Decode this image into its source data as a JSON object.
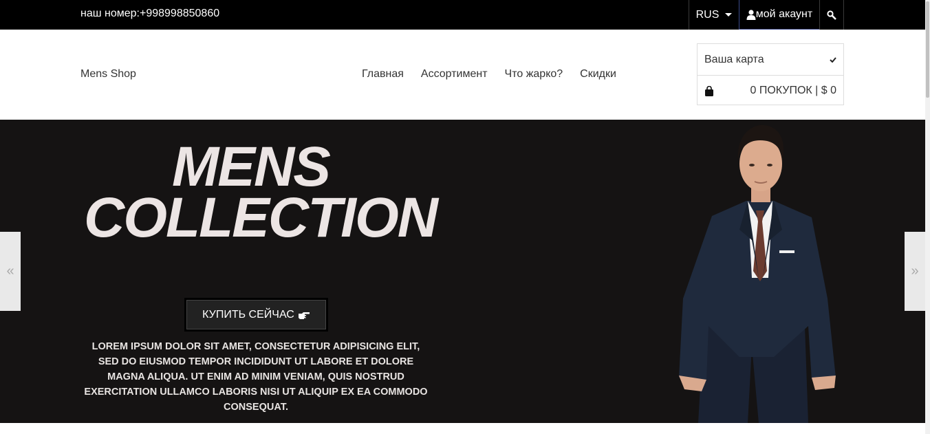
{
  "topbar": {
    "phone": "наш номер:+998998850860",
    "language": "RUS",
    "account": "мой акаунт"
  },
  "header": {
    "brand": "Mens Shop",
    "nav": [
      "Главная",
      "Ассортимент",
      "Что жарко?",
      "Скидки"
    ],
    "cart": {
      "title": "Ваша карта",
      "summary": "0 ПОКУПОК | $ 0"
    }
  },
  "hero": {
    "title_line1": "MENS",
    "title_line2": "COLLECTION",
    "buy_button": "КУПИТЬ СЕЙЧАС",
    "description": "LOREM IPSUM DOLOR SIT AMET, CONSECTETUR ADIPISICING ELIT, SED DO EIUSMOD TEMPOR INCIDIDUNT UT LABORE ET DOLORE MAGNA ALIQUA. UT ENIM AD MINIM VENIAM, QUIS NOSTRUD EXERCITATION ULLAMCO LABORIS NISI UT ALIQUIP EX EA COMMODO CONSEQUAT.",
    "prev_arrow": "«",
    "next_arrow": "»"
  }
}
